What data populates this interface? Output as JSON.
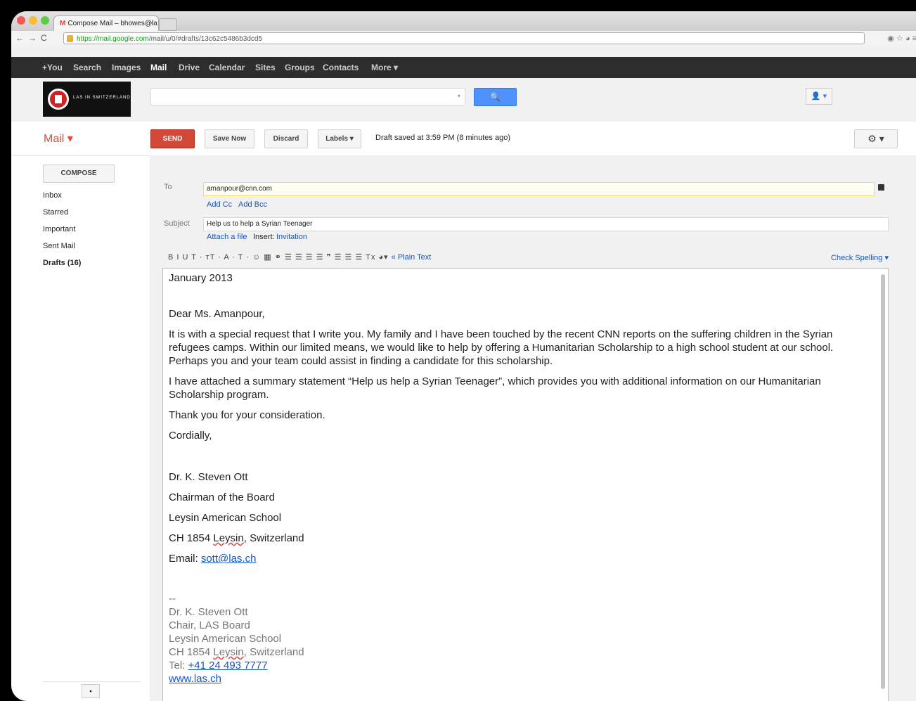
{
  "browser": {
    "tab_title": "Compose Mail – bhowes@la",
    "tab_close": "×",
    "url_secure": "https://mail.google.com",
    "url_path": "/mail/u/0/#drafts/13c62c5486b3dcd5",
    "nav_back": "←",
    "nav_forward": "→",
    "nav_reload": "C"
  },
  "gbar": {
    "items": [
      "+You",
      "Search",
      "Images",
      "Mail",
      "Drive",
      "Calendar",
      "Sites",
      "Groups",
      "Contacts",
      "More ▾"
    ]
  },
  "header": {
    "logo_text": "LAS IN SWITZERLAND",
    "search_button": "🔍",
    "account": "👤 ▾"
  },
  "toolbar": {
    "mail_label": "Mail ▾",
    "send": "SEND",
    "save_now": "Save Now",
    "discard": "Discard",
    "labels": "Labels ▾",
    "draft_status": "Draft saved at 3:59 PM (8 minutes ago)",
    "settings": "⚙ ▾"
  },
  "sidebar": {
    "compose": "COMPOSE",
    "items": [
      {
        "label": "Inbox",
        "bold": false
      },
      {
        "label": "Starred",
        "bold": false
      },
      {
        "label": "Important",
        "bold": false
      },
      {
        "label": "Sent Mail",
        "bold": false
      },
      {
        "label": "Drafts (16)",
        "bold": true
      }
    ],
    "chat": "▪"
  },
  "compose": {
    "to_label": "To",
    "to_value": "amanpour@cnn.com",
    "add_cc": "Add Cc",
    "add_bcc": "Add Bcc",
    "subject_label": "Subject",
    "subject_value": "Help us to help a Syrian Teenager",
    "attach": "Attach a file",
    "insert": "Insert:",
    "invitation": "Invitation",
    "format_icons": "B  I  U  T · ᴛT · A · T · ☺ ▦ ⚭ ☰ ☰ ☰ ☰ ❞ ☰ ☰ ☰ Tx ◕▾",
    "plain_text": "« Plain Text",
    "check_spelling": "Check Spelling ▾"
  },
  "body": {
    "date": "January 2013",
    "salutation": "Dear Ms. Amanpour,",
    "para1": "It is with a special request that I write you. My family and I have been touched by the recent CNN reports on the suffering children in the Syrian refugees camps.  Within our limited means, we would like to help by offering a Humanitarian Scholarship to a high school student at our school. Perhaps you and your team could assist in finding a candidate for this scholarship.",
    "para2": "I have attached a summary statement “Help us help a Syrian Teenager”, which provides you with additional information on our Humanitarian Scholarship program.",
    "para3": "Thank you for your consideration.",
    "closing": "Cordially,",
    "name": "Dr. K. Steven Ott",
    "title": "Chairman of the Board",
    "school": "Leysin American School",
    "address_pre": "CH 1854 ",
    "address_town": "Leysin",
    "address_post": ", Switzerland",
    "email_label": "Email: ",
    "email": "sott@las.ch"
  },
  "signature": {
    "dashes": "--",
    "name": "Dr. K. Steven Ott",
    "role": "Chair, LAS Board",
    "school": "Leysin American School",
    "address_pre": "CH 1854 ",
    "address_town": "Leysin",
    "address_post": ", Switzerland",
    "tel_label": "Tel: ",
    "tel": "+41 24 493 7777",
    "web": "www.las.ch"
  },
  "colors": {
    "send": "#d14836",
    "link": "#1155cc",
    "search": "#4d90fe",
    "mail": "#dd4b39"
  }
}
